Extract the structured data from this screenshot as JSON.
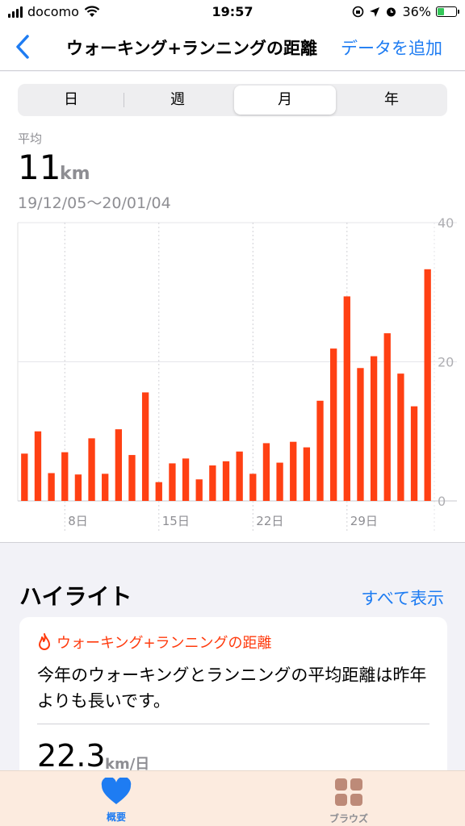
{
  "status": {
    "carrier": "docomo",
    "time": "19:57",
    "battery": "36%",
    "battery_level": 0.36
  },
  "nav": {
    "title": "ウォーキング+ランニングの距離",
    "add_data": "データを追加"
  },
  "segments": [
    "日",
    "週",
    "月",
    "年"
  ],
  "selected_segment": "月",
  "summary": {
    "label": "平均",
    "value": "11",
    "unit": "km",
    "date_range": "19/12/05〜20/01/04"
  },
  "chart_data": {
    "type": "bar",
    "ylim": [
      0,
      40
    ],
    "y_ticks": [
      0,
      20,
      40
    ],
    "x_tick_labels": [
      "8日",
      "15日",
      "22日",
      "29日"
    ],
    "x_tick_positions": [
      3.5,
      10.5,
      17.5,
      24.5
    ],
    "bar_color": "#ff4013",
    "grid": true,
    "values": [
      6.8,
      10,
      4,
      7,
      3.8,
      9,
      3.9,
      10.3,
      6.6,
      15.6,
      2.7,
      5.4,
      6.1,
      3.1,
      5.1,
      5.7,
      7.1,
      3.9,
      8.3,
      5.5,
      8.5,
      7.7,
      14.4,
      21.9,
      29.4,
      19.1,
      20.8,
      24.1,
      18.3,
      13.6,
      33.3
    ]
  },
  "highlights": {
    "title": "ハイライト",
    "show_all": "すべて表示",
    "card": {
      "category": "ウォーキング+ランニングの距離",
      "text": "今年のウォーキングとランニングの平均距離は昨年よりも長いです。",
      "value": "22.3",
      "unit": "km/日"
    }
  },
  "tabs": [
    {
      "label": "概要",
      "color": "#1e7cf2"
    },
    {
      "label": "ブラウズ",
      "color": "#8e8e93"
    }
  ]
}
